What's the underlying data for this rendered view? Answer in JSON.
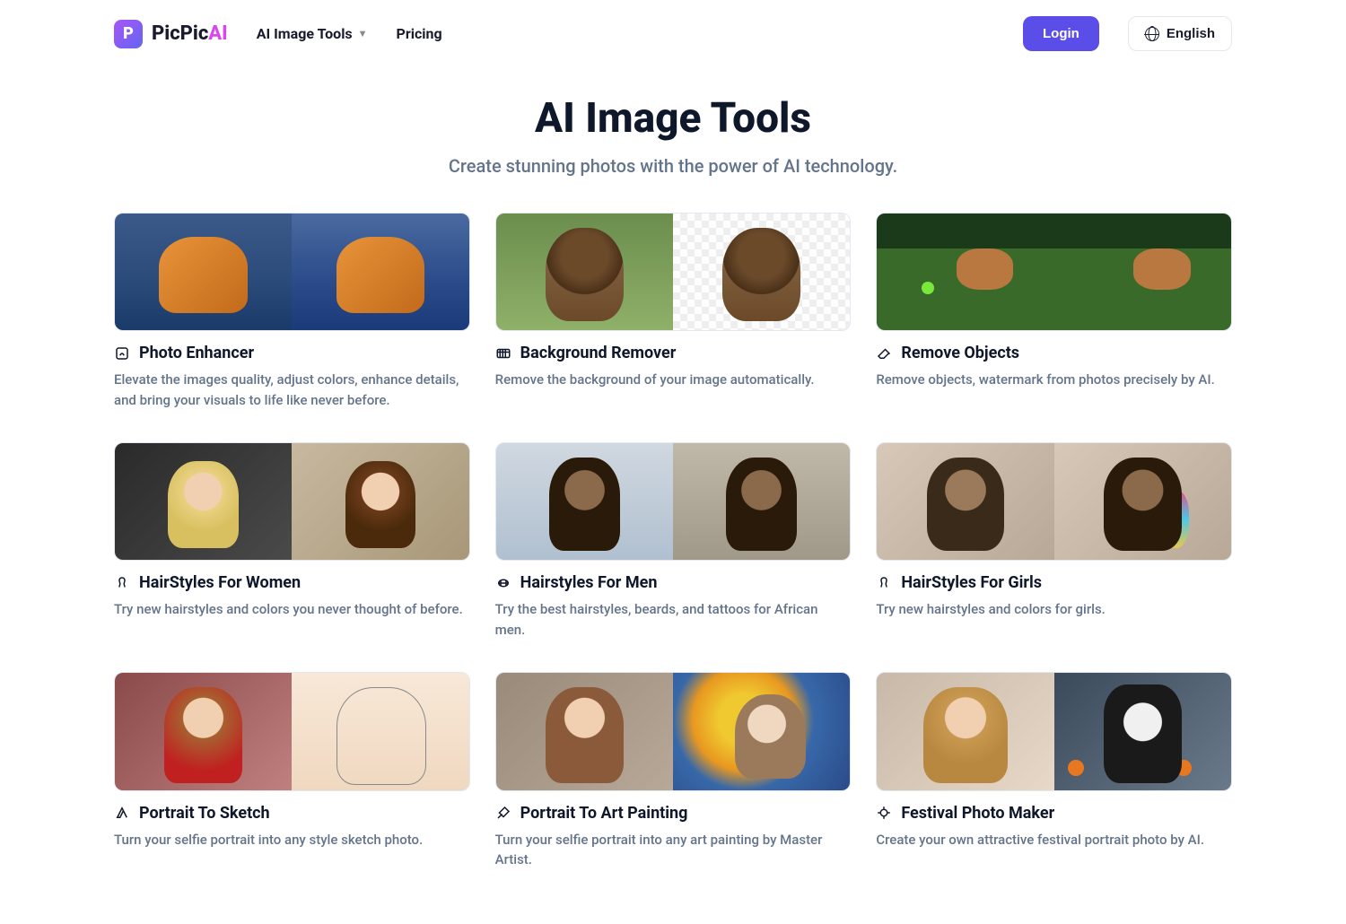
{
  "brand": {
    "prefix": "PicPic",
    "suffix": "AI",
    "mark": "P"
  },
  "nav": {
    "tools": "AI Image Tools",
    "pricing": "Pricing"
  },
  "actions": {
    "login": "Login",
    "language": "English"
  },
  "hero": {
    "title": "AI Image Tools",
    "subtitle": "Create stunning photos with the power of AI technology."
  },
  "tools": [
    {
      "title": "Photo Enhancer",
      "desc": "Elevate the images quality, adjust colors, enhance details, and bring your visuals to life like never before.",
      "icon": "enhance",
      "imgL": "fox-l",
      "imgR": "fox-r"
    },
    {
      "title": "Background Remover",
      "desc": "Remove the background of your image automatically.",
      "icon": "bgremove",
      "imgL": "bgremove-l",
      "imgR": "bgremove-r"
    },
    {
      "title": "Remove Objects",
      "desc": "Remove objects, watermark from photos precisely by AI.",
      "icon": "eraser",
      "imgL": "removeobj-l",
      "imgR": "removeobj-r"
    },
    {
      "title": "HairStyles For Women",
      "desc": "Try new hairstyles and colors you never thought of before.",
      "icon": "hair",
      "imgL": "hair-w-l",
      "imgR": "hair-w-r"
    },
    {
      "title": "Hairstyles For Men",
      "desc": "Try the best hairstyles, beards, and tattoos for African men.",
      "icon": "hairmen",
      "imgL": "hair-m-l",
      "imgR": "hair-m-r"
    },
    {
      "title": "HairStyles For Girls",
      "desc": "Try new hairstyles and colors for girls.",
      "icon": "hair",
      "imgL": "hair-g-l",
      "imgR": "hair-g-r"
    },
    {
      "title": "Portrait To Sketch",
      "desc": "Turn your selfie portrait into any style sketch photo.",
      "icon": "sketch",
      "imgL": "sketch-l",
      "imgR": "sketch-r"
    },
    {
      "title": "Portrait To Art Painting",
      "desc": "Turn your selfie portrait into any art painting by Master Artist.",
      "icon": "paint",
      "imgL": "paint-l",
      "imgR": "paint-r"
    },
    {
      "title": "Festival Photo Maker",
      "desc": "Create your own attractive festival portrait photo by AI.",
      "icon": "festival",
      "imgL": "fest-l",
      "imgR": "fest-r"
    }
  ]
}
